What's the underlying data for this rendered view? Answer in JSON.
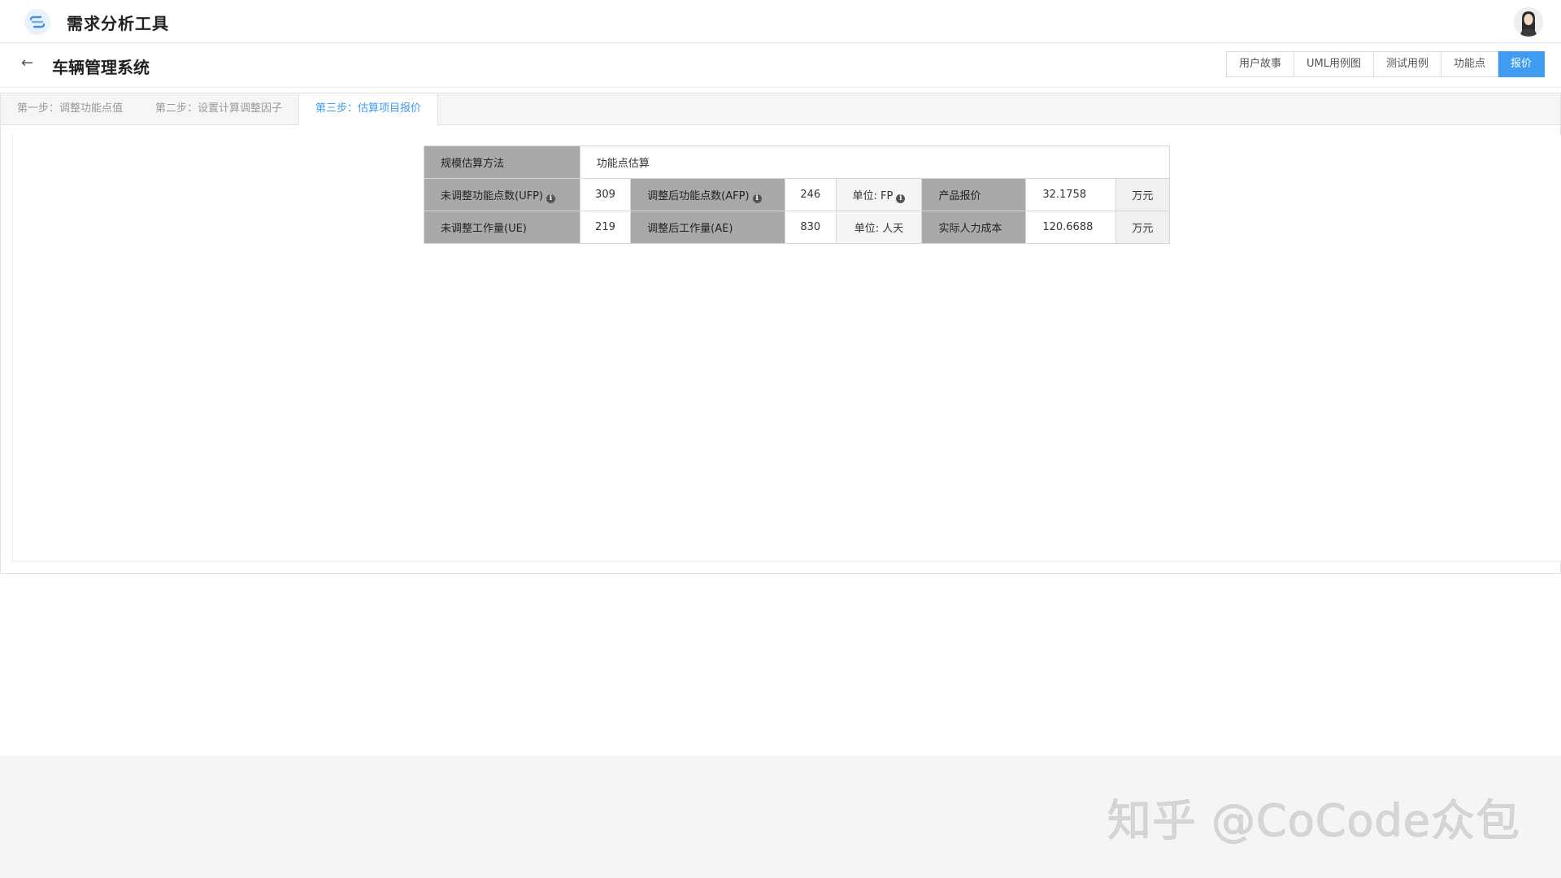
{
  "app": {
    "title": "需求分析工具"
  },
  "project": {
    "back_label": "←",
    "title": "车辆管理系统"
  },
  "top_tabs": [
    {
      "label": "用户故事",
      "active": false
    },
    {
      "label": "UML用例图",
      "active": false
    },
    {
      "label": "测试用例",
      "active": false
    },
    {
      "label": "功能点",
      "active": false
    },
    {
      "label": "报价",
      "active": true
    }
  ],
  "steps": [
    {
      "label": "第一步：调整功能点值",
      "active": false
    },
    {
      "label": "第二步：设置计算调整因子",
      "active": false
    },
    {
      "label": "第三步：估算项目报价",
      "active": true
    }
  ],
  "estimate": {
    "method_label": "规模估算方法",
    "method_value": "功能点估算",
    "ufp_label": "未调整功能点数(UFP)",
    "ufp_value": "309",
    "afp_label": "调整后功能点数(AFP)",
    "afp_value": "246",
    "fp_unit_label": "单位: FP",
    "quote_label": "产品报价",
    "quote_value": "32.1758",
    "quote_unit": "万元",
    "ue_label": "未调整工作量(UE)",
    "ue_value": "219",
    "ae_label": "调整后工作量(AE)",
    "ae_value": "830",
    "day_unit_label": "单位: 人天",
    "cost_label": "实际人力成本",
    "cost_value": "120.6688",
    "cost_unit": "万元"
  },
  "watermark": "知乎 @CoCode众包",
  "colors": {
    "accent": "#3f9cf0",
    "header_cell": "#a9a9a9"
  }
}
